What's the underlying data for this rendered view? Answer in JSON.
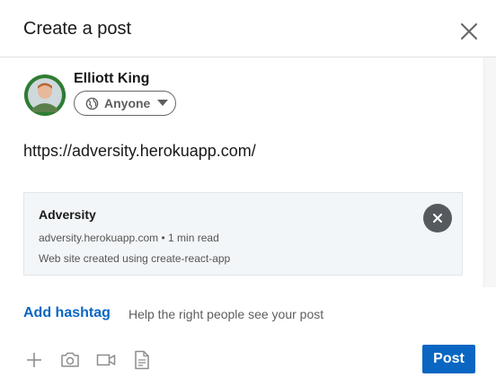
{
  "dialog": {
    "title": "Create a post",
    "close_icon": "close-icon"
  },
  "author": {
    "name": "Elliott King",
    "avatar_icon": "avatar-photo",
    "audience": {
      "label": "Anyone",
      "icon": "globe-icon",
      "caret_icon": "caret-down-icon"
    }
  },
  "post": {
    "text": "https://adversity.herokuapp.com/"
  },
  "link_preview": {
    "title": "Adversity",
    "meta": "adversity.herokuapp.com • 1 min read",
    "description": "Web site created using create-react-app",
    "remove_icon": "remove-preview-icon"
  },
  "hashtag": {
    "link_label": "Add hashtag",
    "help_text": "Help the right people see your post"
  },
  "toolbar": {
    "tools": [
      "plus-icon",
      "camera-icon",
      "video-icon",
      "document-icon"
    ],
    "post_label": "Post"
  },
  "colors": {
    "accent": "#0a66c2",
    "preview_bg": "#f3f6f8",
    "remove_btn": "#555a5f"
  }
}
